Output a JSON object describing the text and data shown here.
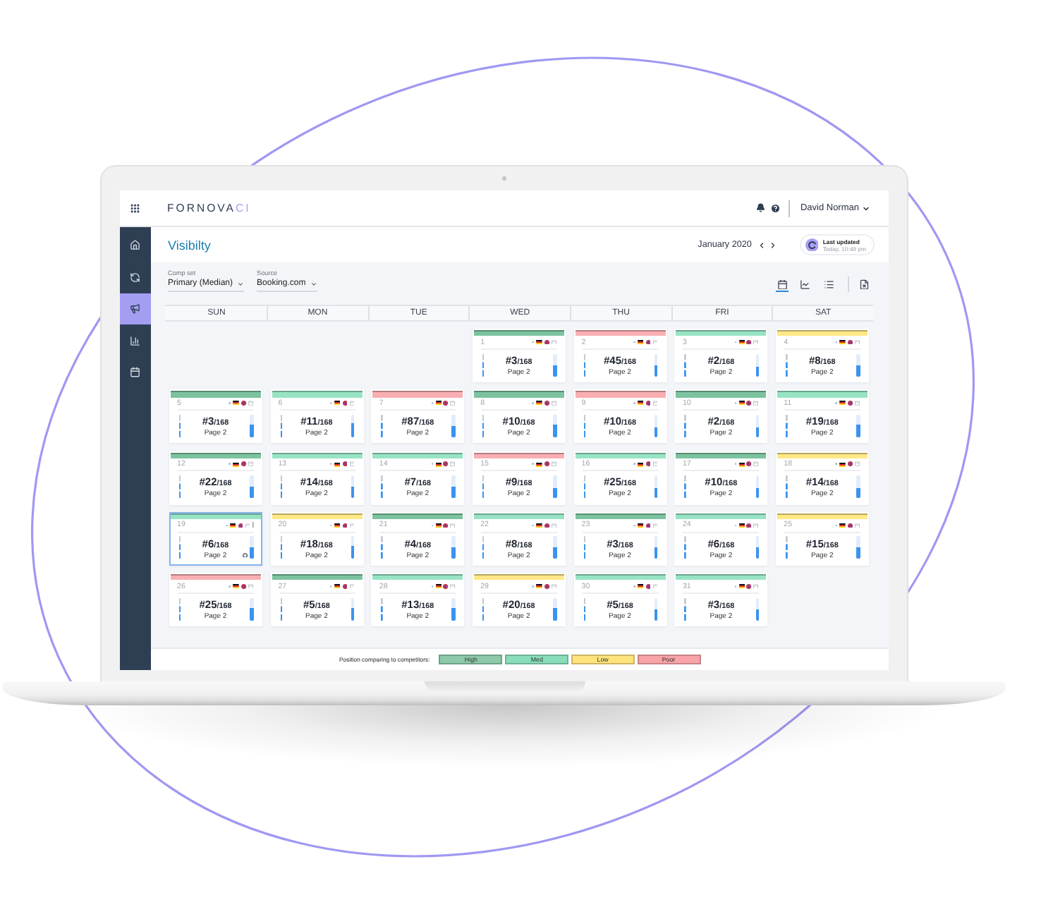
{
  "app": {
    "logo": "FORNOVA",
    "logo_accent": "CI",
    "user": "David Norman"
  },
  "sidebar": {
    "items": [
      {
        "kind": "home",
        "selected": false
      },
      {
        "kind": "sync",
        "selected": false
      },
      {
        "kind": "campaign",
        "selected": true
      },
      {
        "kind": "chart",
        "selected": false
      },
      {
        "kind": "calendar",
        "selected": false
      }
    ]
  },
  "page": {
    "title": "Visibilty",
    "month": "January 2020",
    "last_updated": {
      "label": "Last updated",
      "time": "Today, 10:49 pm"
    }
  },
  "filters": [
    {
      "label": "Comp set",
      "value": "Primary (Median)"
    },
    {
      "label": "Source",
      "value": "Booking.com"
    }
  ],
  "views": [
    {
      "kind": "calendar",
      "selected": true
    },
    {
      "kind": "chart",
      "selected": false
    },
    {
      "kind": "list",
      "selected": false
    }
  ],
  "calendar": {
    "weekdays": [
      "SUN",
      "MON",
      "TUE",
      "WED",
      "THU",
      "FRI",
      "SAT"
    ],
    "weeks": [
      [
        {
          "kind": "empty"
        },
        {
          "kind": "empty"
        },
        {
          "kind": "empty"
        },
        {
          "kind": "day",
          "date": "1",
          "color": "#7cc3a0",
          "rank": "#3",
          "total": "/168",
          "page": "Page 2",
          "level": 0.47,
          "selected": false
        },
        {
          "kind": "day",
          "date": "2",
          "color": "#f9afb2",
          "rank": "#45",
          "total": "/168",
          "page": "Page 2",
          "level": 0.47,
          "selected": false
        },
        {
          "kind": "day",
          "date": "3",
          "color": "#97e4c4",
          "rank": "#2",
          "total": "/168",
          "page": "Page 2",
          "level": 0.4,
          "selected": false
        },
        {
          "kind": "day",
          "date": "4",
          "color": "#ffe885",
          "rank": "#8",
          "total": "/168",
          "page": "Page 2",
          "level": 0.47,
          "selected": false
        }
      ],
      [
        {
          "kind": "day",
          "date": "5",
          "color": "#7cc3a0",
          "rank": "#3",
          "total": "/168",
          "page": "Page 2",
          "level": 0.58,
          "selected": false
        },
        {
          "kind": "day",
          "date": "6",
          "color": "#97e4c4",
          "rank": "#11",
          "total": "/168",
          "page": "Page 2",
          "level": 0.62,
          "selected": false
        },
        {
          "kind": "day",
          "date": "7",
          "color": "#f9afb2",
          "rank": "#87",
          "total": "/168",
          "page": "Page 2",
          "level": 0.48,
          "selected": false
        },
        {
          "kind": "day",
          "date": "8",
          "color": "#7cc3a0",
          "rank": "#10",
          "total": "/168",
          "page": "Page 2",
          "level": 0.55,
          "selected": false
        },
        {
          "kind": "day",
          "date": "9",
          "color": "#f9afb2",
          "rank": "#10",
          "total": "/168",
          "page": "Page 2",
          "level": 0.44,
          "selected": false
        },
        {
          "kind": "day",
          "date": "10",
          "color": "#7cc3a0",
          "rank": "#2",
          "total": "/168",
          "page": "Page 2",
          "level": 0.44,
          "selected": false
        },
        {
          "kind": "day",
          "date": "11",
          "color": "#97e4c4",
          "rank": "#19",
          "total": "/168",
          "page": "Page 2",
          "level": 0.55,
          "selected": false
        }
      ],
      [
        {
          "kind": "day",
          "date": "12",
          "color": "#7cc3a0",
          "rank": "#22",
          "total": "/168",
          "page": "Page 2",
          "level": 0.54,
          "selected": false
        },
        {
          "kind": "day",
          "date": "13",
          "color": "#97e4c4",
          "rank": "#14",
          "total": "/168",
          "page": "Page 2",
          "level": 0.5,
          "selected": false
        },
        {
          "kind": "day",
          "date": "14",
          "color": "#97e4c4",
          "rank": "#7",
          "total": "/168",
          "page": "Page 2",
          "level": 0.54,
          "selected": false
        },
        {
          "kind": "day",
          "date": "15",
          "color": "#f9afb2",
          "rank": "#9",
          "total": "/168",
          "page": "Page 2",
          "level": 0.42,
          "selected": false
        },
        {
          "kind": "day",
          "date": "16",
          "color": "#97e4c4",
          "rank": "#25",
          "total": "/168",
          "page": "Page 2",
          "level": 0.42,
          "selected": false
        },
        {
          "kind": "day",
          "date": "17",
          "color": "#7cc3a0",
          "rank": "#10",
          "total": "/168",
          "page": "Page 2",
          "level": 0.42,
          "selected": false
        },
        {
          "kind": "day",
          "date": "18",
          "color": "#ffe885",
          "rank": "#14",
          "total": "/168",
          "page": "Page 2",
          "level": 0.42,
          "selected": false
        }
      ],
      [
        {
          "kind": "day",
          "date": "19",
          "color": "#97e4c4",
          "rank": "#6",
          "total": "/168",
          "page": "Page 2",
          "level": 0.55,
          "selected": true
        },
        {
          "kind": "day",
          "date": "20",
          "color": "#ffe885",
          "rank": "#18",
          "total": "/168",
          "page": "Page 2",
          "level": 0.62,
          "selected": false
        },
        {
          "kind": "day",
          "date": "21",
          "color": "#7cc3a0",
          "rank": "#4",
          "total": "/168",
          "page": "Page 2",
          "level": 0.55,
          "selected": false
        },
        {
          "kind": "day",
          "date": "22",
          "color": "#97e4c4",
          "rank": "#8",
          "total": "/168",
          "page": "Page 2",
          "level": 0.5,
          "selected": false
        },
        {
          "kind": "day",
          "date": "23",
          "color": "#7cc3a0",
          "rank": "#3",
          "total": "/168",
          "page": "Page 2",
          "level": 0.5,
          "selected": false
        },
        {
          "kind": "day",
          "date": "24",
          "color": "#97e4c4",
          "rank": "#6",
          "total": "/168",
          "page": "Page 2",
          "level": 0.5,
          "selected": false
        },
        {
          "kind": "day",
          "date": "25",
          "color": "#ffe885",
          "rank": "#15",
          "total": "/168",
          "page": "Page 2",
          "level": 0.5,
          "selected": false
        }
      ],
      [
        {
          "kind": "day",
          "date": "26",
          "color": "#f9afb2",
          "rank": "#25",
          "total": "/168",
          "page": "Page 2",
          "level": 0.55,
          "selected": false
        },
        {
          "kind": "day",
          "date": "27",
          "color": "#7cc3a0",
          "rank": "#5",
          "total": "/168",
          "page": "Page 2",
          "level": 0.55,
          "selected": false
        },
        {
          "kind": "day",
          "date": "28",
          "color": "#97e4c4",
          "rank": "#13",
          "total": "/168",
          "page": "Page 2",
          "level": 0.55,
          "selected": false
        },
        {
          "kind": "day",
          "date": "29",
          "color": "#ffe885",
          "rank": "#20",
          "total": "/168",
          "page": "Page 2",
          "level": 0.53,
          "selected": false
        },
        {
          "kind": "day",
          "date": "30",
          "color": "#97e4c4",
          "rank": "#5",
          "total": "/168",
          "page": "Page 2",
          "level": 0.5,
          "selected": false
        },
        {
          "kind": "day",
          "date": "31",
          "color": "#97e4c4",
          "rank": "#3",
          "total": "/168",
          "page": "Page 2",
          "level": 0.5,
          "selected": false
        }
      ]
    ]
  },
  "legend": {
    "label": "Position comparing to competitors:",
    "items": [
      {
        "label": "High",
        "color": "#8dcaa9"
      },
      {
        "label": "Med",
        "color": "#89ddba"
      },
      {
        "label": "Low",
        "color": "#ffe47c"
      },
      {
        "label": "Poor",
        "color": "#f8a4a9"
      }
    ]
  }
}
